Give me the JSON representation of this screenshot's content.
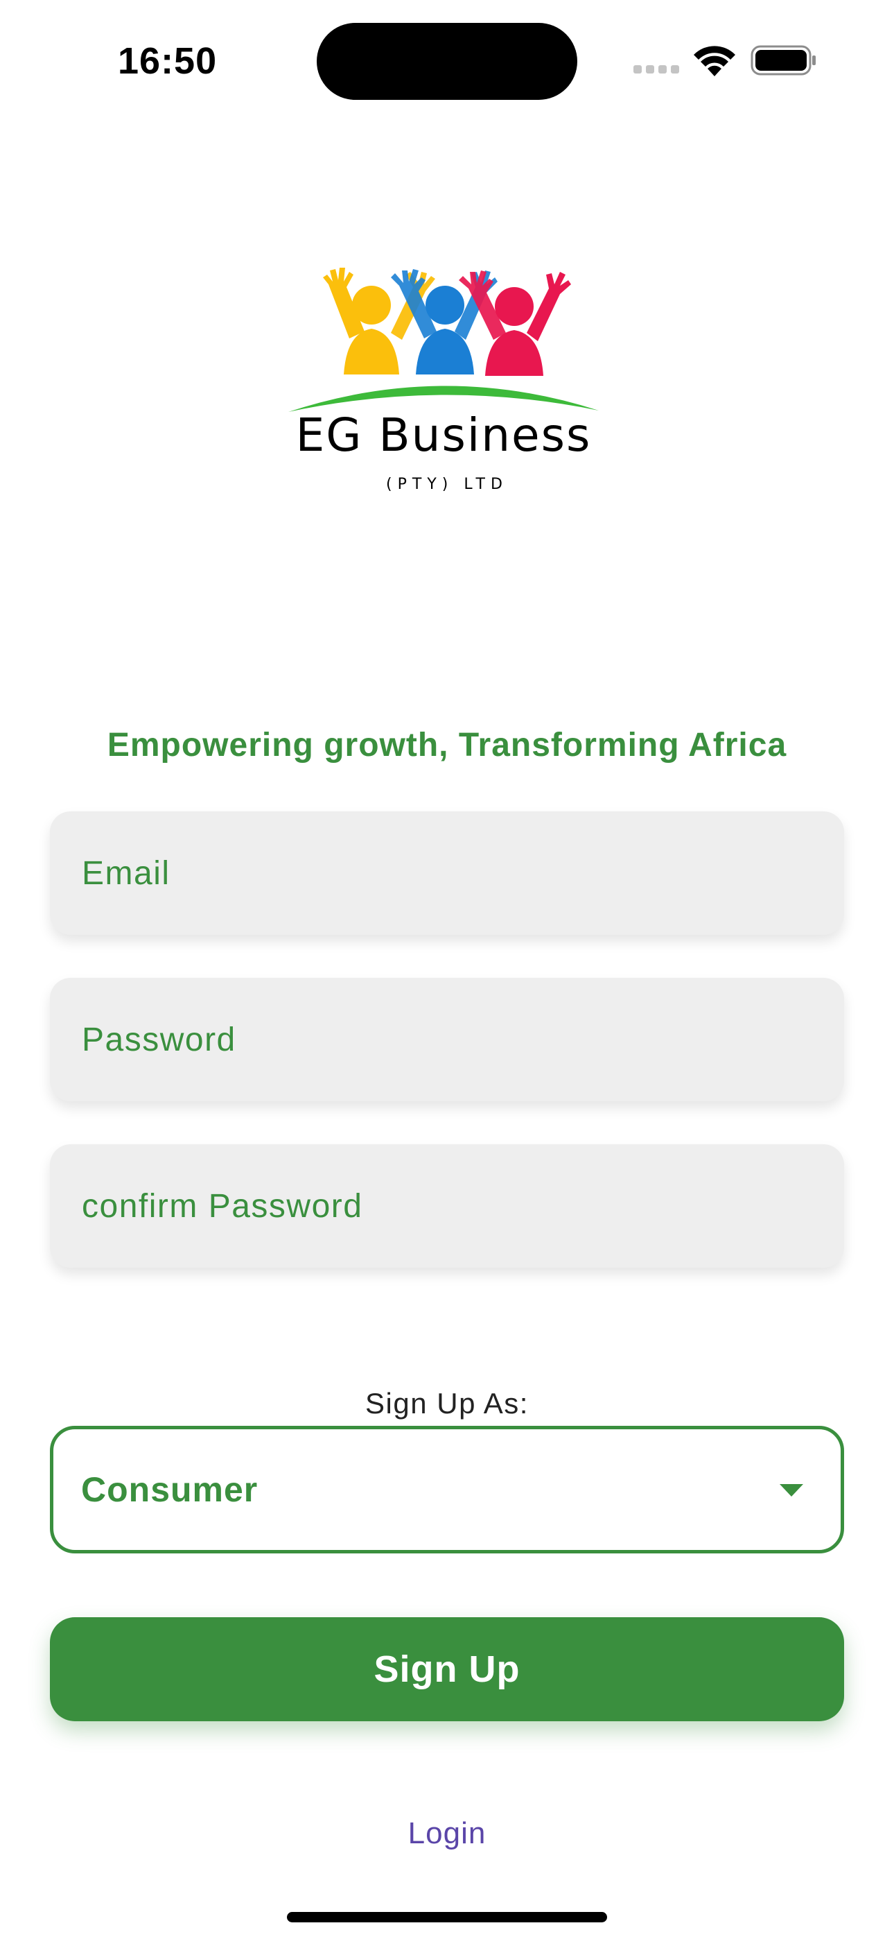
{
  "status_bar": {
    "time": "16:50"
  },
  "logo": {
    "title": "EG Business",
    "subtitle": "(PTY) LTD",
    "colors": {
      "yellow": "#fbbf0c",
      "blue": "#1b7fd4",
      "red": "#e8174f",
      "green": "#3dba3a"
    }
  },
  "tagline": "Empowering growth, Transforming Africa",
  "form": {
    "email_placeholder": "Email",
    "password_placeholder": "Password",
    "confirm_password_placeholder": "confirm Password",
    "signup_as_label": "Sign Up As:",
    "role_selected": "Consumer",
    "dropdown_icon": "chevron-down-icon",
    "signup_button": "Sign Up",
    "login_link": "Login"
  },
  "theme": {
    "primary": "#3a8f3e",
    "field_bg": "#eeeeee",
    "link": "#5a45a8"
  }
}
